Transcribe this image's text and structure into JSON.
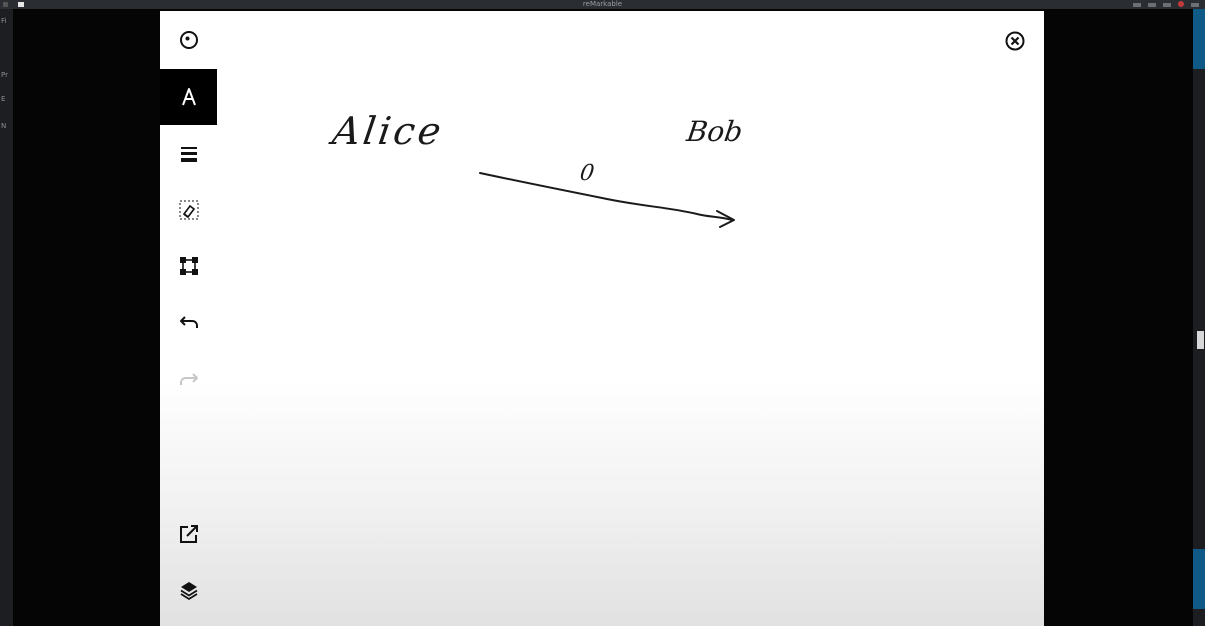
{
  "desktop": {
    "window_title": "reMarkable"
  },
  "left_strip_text": [
    "Fi",
    "Pr",
    "E",
    "N"
  ],
  "toolbar": {
    "items": [
      {
        "name": "menu-icon",
        "state": "normal"
      },
      {
        "name": "pen-tool-icon",
        "state": "active"
      },
      {
        "name": "line-thickness-icon",
        "state": "normal"
      },
      {
        "name": "eraser-icon",
        "state": "normal"
      },
      {
        "name": "selection-icon",
        "state": "normal"
      },
      {
        "name": "undo-icon",
        "state": "normal"
      },
      {
        "name": "redo-icon",
        "state": "disabled"
      },
      {
        "name": "share-icon",
        "state": "normal"
      },
      {
        "name": "layers-icon",
        "state": "normal"
      }
    ],
    "close_icon": "close-circle-icon"
  },
  "canvas": {
    "labels": {
      "alice": "Alice",
      "bob": "Bob",
      "arrow_value": "0"
    }
  },
  "colors": {
    "ink": "#1a1a1a",
    "active_tool_bg": "#000000",
    "disabled_icon": "#c7c7c7",
    "taskbar_accent": "#0f5a86"
  }
}
